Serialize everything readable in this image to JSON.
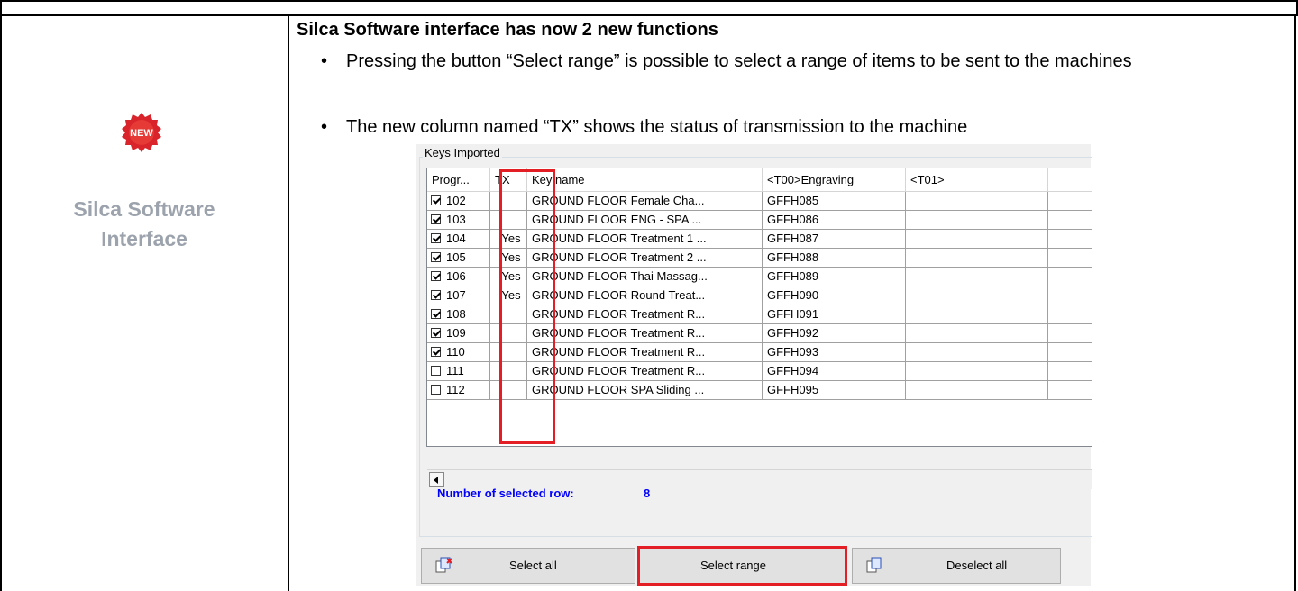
{
  "sidebar": {
    "badge_text": "NEW",
    "title_line1": "Silca Software",
    "title_line2": "Interface"
  },
  "content": {
    "heading": "Silca Software interface has now 2 new functions",
    "bullets": [
      "Pressing the button “Select range” is possible to select a range of items to be sent to the machines",
      "The new column named “TX” shows the status of transmission to the machine"
    ]
  },
  "app": {
    "group_label": "Keys Imported",
    "columns": [
      "Progr...",
      "TX",
      "Key name",
      "<T00>Engraving",
      "<T01>"
    ],
    "rows": [
      {
        "checked": true,
        "progr": "102",
        "tx": "",
        "key_name": "GROUND FLOOR Female Cha...",
        "engraving": "GFFH085",
        "t01": ""
      },
      {
        "checked": true,
        "progr": "103",
        "tx": "",
        "key_name": "GROUND FLOOR ENG - SPA ...",
        "engraving": "GFFH086",
        "t01": ""
      },
      {
        "checked": true,
        "progr": "104",
        "tx": "Yes",
        "key_name": "GROUND FLOOR Treatment 1 ...",
        "engraving": "GFFH087",
        "t01": ""
      },
      {
        "checked": true,
        "progr": "105",
        "tx": "Yes",
        "key_name": "GROUND FLOOR Treatment 2 ...",
        "engraving": "GFFH088",
        "t01": ""
      },
      {
        "checked": true,
        "progr": "106",
        "tx": "Yes",
        "key_name": "GROUND FLOOR Thai Massag...",
        "engraving": "GFFH089",
        "t01": ""
      },
      {
        "checked": true,
        "progr": "107",
        "tx": "Yes",
        "key_name": "GROUND FLOOR Round Treat...",
        "engraving": "GFFH090",
        "t01": ""
      },
      {
        "checked": true,
        "progr": "108",
        "tx": "",
        "key_name": "GROUND FLOOR Treatment R...",
        "engraving": "GFFH091",
        "t01": ""
      },
      {
        "checked": true,
        "progr": "109",
        "tx": "",
        "key_name": "GROUND FLOOR Treatment R...",
        "engraving": "GFFH092",
        "t01": ""
      },
      {
        "checked": true,
        "progr": "110",
        "tx": "",
        "key_name": "GROUND FLOOR Treatment R...",
        "engraving": "GFFH093",
        "t01": ""
      },
      {
        "checked": false,
        "progr": "111",
        "tx": "",
        "key_name": "GROUND FLOOR Treatment R...",
        "engraving": "GFFH094",
        "t01": ""
      },
      {
        "checked": false,
        "progr": "112",
        "tx": "",
        "key_name": "GROUND FLOOR SPA Sliding ...",
        "engraving": "GFFH095",
        "t01": ""
      }
    ],
    "selected_count_label": "Number of selected row:",
    "selected_count": "8",
    "buttons": {
      "select_all": "Select all",
      "select_range": "Select range",
      "deselect_all": "Deselect all"
    },
    "highlight_color": "#e31e24",
    "count_color": "#0000ff"
  }
}
